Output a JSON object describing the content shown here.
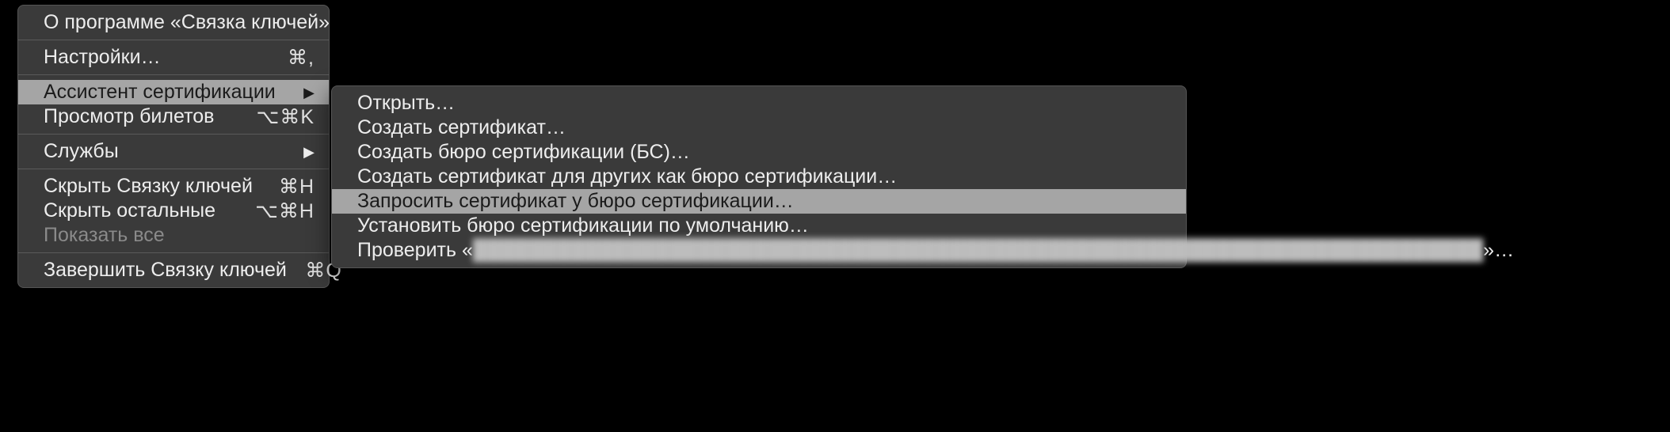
{
  "main_menu": {
    "about": "О программе «Связка ключей»",
    "preferences": {
      "label": "Настройки…",
      "shortcut": "⌘,"
    },
    "cert_assistant": {
      "label": "Ассистент сертификации"
    },
    "ticket_viewer": {
      "label": "Просмотр билетов",
      "shortcut": "⌥⌘K"
    },
    "services": {
      "label": "Службы"
    },
    "hide": {
      "label": "Скрыть Связку ключей",
      "shortcut": "⌘H"
    },
    "hide_others": {
      "label": "Скрыть остальные",
      "shortcut": "⌥⌘H"
    },
    "show_all": {
      "label": "Показать все"
    },
    "quit": {
      "label": "Завершить Связку ключей",
      "shortcut": "⌘Q"
    }
  },
  "sub_menu": {
    "open": "Открыть…",
    "create_cert": "Создать сертификат…",
    "create_ca": "Создать бюро сертификации (БС)…",
    "create_cert_others": "Создать сертификат для других как бюро сертификации…",
    "request_cert": "Запросить сертификат у бюро сертификации…",
    "set_default_ca": "Установить бюро сертификации по умолчанию…",
    "evaluate_prefix": "Проверить «",
    "evaluate_blurred": "████████████████████████████████████████████████████████████████████████",
    "evaluate_suffix": "»…"
  }
}
